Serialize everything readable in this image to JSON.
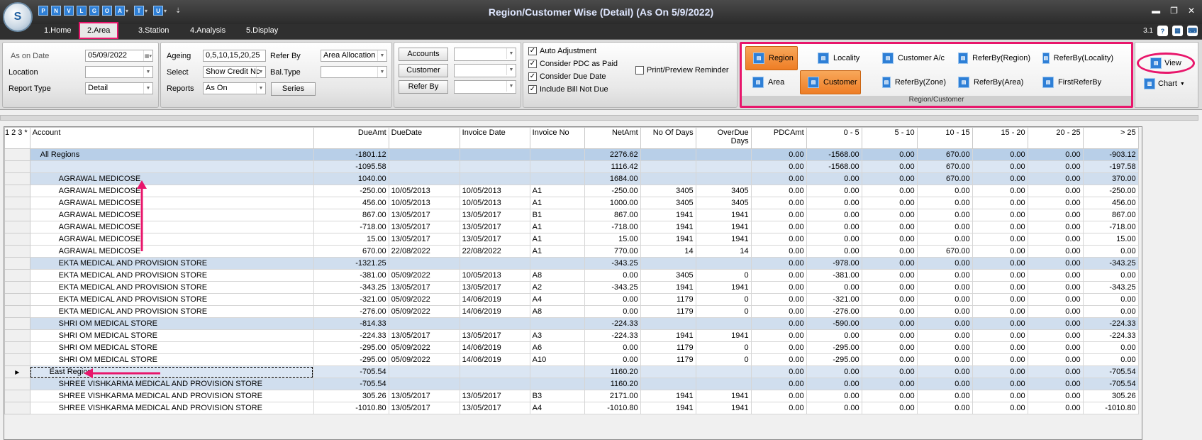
{
  "app": {
    "title": "Region/Customer Wise  (Detail) (As On 5/9/2022)",
    "logo_text": "S",
    "qat": [
      {
        "icon": "print-icon",
        "label": "P"
      },
      {
        "icon": "new-icon",
        "label": "N"
      },
      {
        "icon": "view-icon",
        "label": "V"
      },
      {
        "icon": "layout-icon",
        "label": "L"
      },
      {
        "icon": "chart-icon",
        "label": "G"
      },
      {
        "icon": "options-icon",
        "label": "O"
      },
      {
        "icon": "account-icon",
        "label": "A"
      },
      {
        "icon": "tool-icon",
        "label": "T"
      },
      {
        "icon": "user-icon",
        "label": "U"
      }
    ],
    "window_controls": {
      "minimize": "▬",
      "restore": "❐",
      "close": "✕"
    },
    "version": "3.1"
  },
  "menu": {
    "tabs": [
      "1.Home",
      "2.Area",
      "3.Station",
      "4.Analysis",
      "5.Display"
    ],
    "selected": "2.Area"
  },
  "ribbon": {
    "as_on_date_label": "As on Date",
    "as_on_date_value": "05/09/2022",
    "location_label": "Location",
    "location_value": "",
    "report_type_label": "Report Type",
    "report_type_value": "Detail",
    "ageing_label": "Ageing",
    "ageing_value": "0,5,10,15,20,25",
    "select_label": "Select",
    "select_value": "Show Credit Nc",
    "reports_label": "Reports",
    "reports_value": "As On",
    "refer_by_label": "Refer By",
    "refer_by_value": "Area Allocation",
    "bal_type_label": "Bal.Type",
    "bal_type_value": "",
    "series_button": "Series",
    "accounts_button": "Accounts",
    "customer_button": "Customer",
    "refer_by_button": "Refer By",
    "auto_adjustment": "Auto Adjustment",
    "consider_pdc": "Consider PDC as Paid",
    "consider_due_date": "Consider Due Date",
    "include_bill": "Include Bill Not Due",
    "print_preview": "Print/Preview Reminder"
  },
  "region_customer": {
    "caption": "Region/Customer",
    "buttons": [
      {
        "label": "Region",
        "active": true,
        "icon": "region-icon"
      },
      {
        "label": "Locality",
        "active": false,
        "icon": "locality-icon"
      },
      {
        "label": "Customer A/c",
        "active": false,
        "icon": "customer-ac-icon"
      },
      {
        "label": "ReferBy(Region)",
        "active": false,
        "icon": "referby-region-icon"
      },
      {
        "label": "ReferBy(Locality)",
        "active": false,
        "icon": "referby-locality-icon"
      },
      {
        "label": "Area",
        "active": false,
        "icon": "area-icon"
      },
      {
        "label": "Customer",
        "active": true,
        "icon": "customer-icon"
      },
      {
        "label": "ReferBy(Zone)",
        "active": false,
        "icon": "referby-zone-icon"
      },
      {
        "label": "ReferBy(Area)",
        "active": false,
        "icon": "referby-area-icon"
      },
      {
        "label": "FirstReferBy",
        "active": false,
        "icon": "first-referby-icon"
      }
    ]
  },
  "view_group": {
    "view_label": "View",
    "chart_label": "Chart"
  },
  "grid": {
    "group_levels": [
      "1",
      "2",
      "3",
      "*"
    ],
    "columns": [
      "Account",
      "DueAmt",
      "DueDate",
      "Invoice Date",
      "Invoice No",
      "NetAmt",
      "No Of Days",
      "OverDue Days",
      "PDCAmt",
      "0 - 5",
      "5 - 10",
      "10 - 15",
      "15 - 20",
      "20 - 25",
      "> 25"
    ],
    "rows": [
      {
        "level": 0,
        "cells": [
          "All Regions",
          "-1801.12",
          "",
          "",
          "",
          "2276.62",
          "",
          "",
          "0.00",
          "-1568.00",
          "0.00",
          "670.00",
          "0.00",
          "0.00",
          "-903.12"
        ]
      },
      {
        "level": 1,
        "cells": [
          "",
          "-1095.58",
          "",
          "",
          "",
          "1116.42",
          "",
          "",
          "0.00",
          "-1568.00",
          "0.00",
          "670.00",
          "0.00",
          "0.00",
          "-197.58"
        ]
      },
      {
        "level": 2,
        "cells": [
          "AGRAWAL MEDICOSE",
          "1040.00",
          "",
          "",
          "",
          "1684.00",
          "",
          "",
          "0.00",
          "0.00",
          "0.00",
          "670.00",
          "0.00",
          "0.00",
          "370.00"
        ]
      },
      {
        "level": 3,
        "cells": [
          "AGRAWAL MEDICOSE",
          "-250.00",
          "10/05/2013",
          "10/05/2013",
          "A1",
          "-250.00",
          "3405",
          "3405",
          "0.00",
          "0.00",
          "0.00",
          "0.00",
          "0.00",
          "0.00",
          "-250.00"
        ]
      },
      {
        "level": 3,
        "cells": [
          "AGRAWAL MEDICOSE",
          "456.00",
          "10/05/2013",
          "10/05/2013",
          "A1",
          "1000.00",
          "3405",
          "3405",
          "0.00",
          "0.00",
          "0.00",
          "0.00",
          "0.00",
          "0.00",
          "456.00"
        ]
      },
      {
        "level": 3,
        "cells": [
          "AGRAWAL MEDICOSE",
          "867.00",
          "13/05/2017",
          "13/05/2017",
          "B1",
          "867.00",
          "1941",
          "1941",
          "0.00",
          "0.00",
          "0.00",
          "0.00",
          "0.00",
          "0.00",
          "867.00"
        ]
      },
      {
        "level": 3,
        "cells": [
          "AGRAWAL MEDICOSE",
          "-718.00",
          "13/05/2017",
          "13/05/2017",
          "A1",
          "-718.00",
          "1941",
          "1941",
          "0.00",
          "0.00",
          "0.00",
          "0.00",
          "0.00",
          "0.00",
          "-718.00"
        ]
      },
      {
        "level": 3,
        "cells": [
          "AGRAWAL MEDICOSE",
          "15.00",
          "13/05/2017",
          "13/05/2017",
          "A1",
          "15.00",
          "1941",
          "1941",
          "0.00",
          "0.00",
          "0.00",
          "0.00",
          "0.00",
          "0.00",
          "15.00"
        ]
      },
      {
        "level": 3,
        "cells": [
          "AGRAWAL MEDICOSE",
          "670.00",
          "22/08/2022",
          "22/08/2022",
          "A1",
          "770.00",
          "14",
          "14",
          "0.00",
          "0.00",
          "0.00",
          "670.00",
          "0.00",
          "0.00",
          "0.00"
        ]
      },
      {
        "level": 2,
        "cells": [
          "EKTA MEDICAL AND PROVISION STORE",
          "-1321.25",
          "",
          "",
          "",
          "-343.25",
          "",
          "",
          "0.00",
          "-978.00",
          "0.00",
          "0.00",
          "0.00",
          "0.00",
          "-343.25"
        ]
      },
      {
        "level": 3,
        "cells": [
          "EKTA MEDICAL AND PROVISION STORE",
          "-381.00",
          "05/09/2022",
          "10/05/2013",
          "A8",
          "0.00",
          "3405",
          "0",
          "0.00",
          "-381.00",
          "0.00",
          "0.00",
          "0.00",
          "0.00",
          "0.00"
        ]
      },
      {
        "level": 3,
        "cells": [
          "EKTA MEDICAL AND PROVISION STORE",
          "-343.25",
          "13/05/2017",
          "13/05/2017",
          "A2",
          "-343.25",
          "1941",
          "1941",
          "0.00",
          "0.00",
          "0.00",
          "0.00",
          "0.00",
          "0.00",
          "-343.25"
        ]
      },
      {
        "level": 3,
        "cells": [
          "EKTA MEDICAL AND PROVISION STORE",
          "-321.00",
          "05/09/2022",
          "14/06/2019",
          "A4",
          "0.00",
          "1179",
          "0",
          "0.00",
          "-321.00",
          "0.00",
          "0.00",
          "0.00",
          "0.00",
          "0.00"
        ]
      },
      {
        "level": 3,
        "cells": [
          "EKTA MEDICAL AND PROVISION STORE",
          "-276.00",
          "05/09/2022",
          "14/06/2019",
          "A8",
          "0.00",
          "1179",
          "0",
          "0.00",
          "-276.00",
          "0.00",
          "0.00",
          "0.00",
          "0.00",
          "0.00"
        ]
      },
      {
        "level": 2,
        "cells": [
          "SHRI OM MEDICAL STORE",
          "-814.33",
          "",
          "",
          "",
          "-224.33",
          "",
          "",
          "0.00",
          "-590.00",
          "0.00",
          "0.00",
          "0.00",
          "0.00",
          "-224.33"
        ]
      },
      {
        "level": 3,
        "cells": [
          "SHRI OM MEDICAL STORE",
          "-224.33",
          "13/05/2017",
          "13/05/2017",
          "A3",
          "-224.33",
          "1941",
          "1941",
          "0.00",
          "0.00",
          "0.00",
          "0.00",
          "0.00",
          "0.00",
          "-224.33"
        ]
      },
      {
        "level": 3,
        "cells": [
          "SHRI OM MEDICAL STORE",
          "-295.00",
          "05/09/2022",
          "14/06/2019",
          "A6",
          "0.00",
          "1179",
          "0",
          "0.00",
          "-295.00",
          "0.00",
          "0.00",
          "0.00",
          "0.00",
          "0.00"
        ]
      },
      {
        "level": 3,
        "cells": [
          "SHRI OM MEDICAL STORE",
          "-295.00",
          "05/09/2022",
          "14/06/2019",
          "A10",
          "0.00",
          "1179",
          "0",
          "0.00",
          "-295.00",
          "0.00",
          "0.00",
          "0.00",
          "0.00",
          "0.00"
        ]
      },
      {
        "level": 1,
        "current": true,
        "cells": [
          "East Region",
          "-705.54",
          "",
          "",
          "",
          "1160.20",
          "",
          "",
          "0.00",
          "0.00",
          "0.00",
          "0.00",
          "0.00",
          "0.00",
          "-705.54"
        ]
      },
      {
        "level": 2,
        "cells": [
          "SHREE VISHKARMA MEDICAL AND PROVISION STORE",
          "-705.54",
          "",
          "",
          "",
          "1160.20",
          "",
          "",
          "0.00",
          "0.00",
          "0.00",
          "0.00",
          "0.00",
          "0.00",
          "-705.54"
        ]
      },
      {
        "level": 3,
        "cells": [
          "SHREE VISHKARMA MEDICAL AND PROVISION STORE",
          "305.26",
          "13/05/2017",
          "13/05/2017",
          "B3",
          "2171.00",
          "1941",
          "1941",
          "0.00",
          "0.00",
          "0.00",
          "0.00",
          "0.00",
          "0.00",
          "305.26"
        ]
      },
      {
        "level": 3,
        "cells": [
          "SHREE VISHKARMA MEDICAL AND PROVISION STORE",
          "-1010.80",
          "13/05/2017",
          "13/05/2017",
          "A4",
          "-1010.80",
          "1941",
          "1941",
          "0.00",
          "0.00",
          "0.00",
          "0.00",
          "0.00",
          "0.00",
          "-1010.80"
        ]
      }
    ]
  },
  "colors": {
    "highlight": "#e8166b",
    "active_button": "#ee7d25",
    "group_row": "#b8cfe8"
  }
}
